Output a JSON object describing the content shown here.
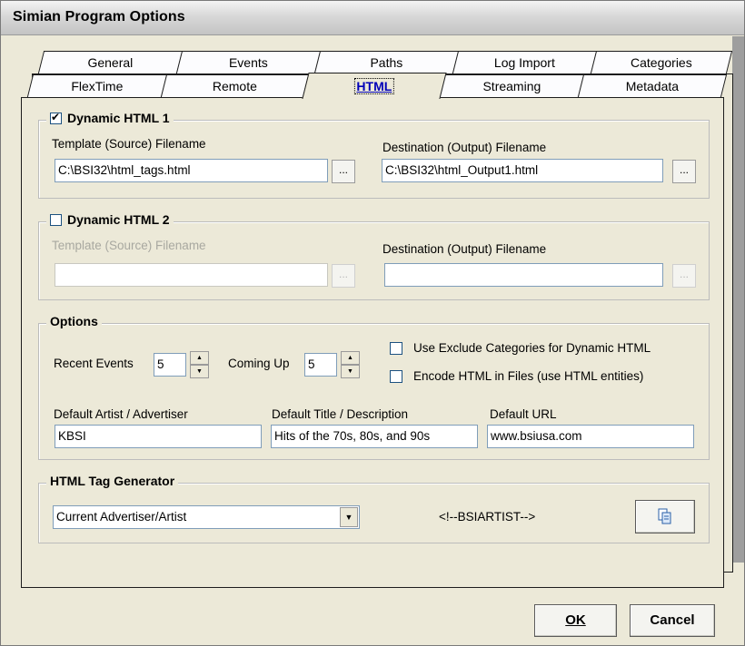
{
  "window": {
    "title": "Simian Program Options"
  },
  "tabs": {
    "row1": [
      "General",
      "Events",
      "Paths",
      "Log Import",
      "Categories"
    ],
    "row2": [
      "FlexTime",
      "Remote",
      "HTML",
      "Streaming",
      "Metadata"
    ],
    "active": "HTML"
  },
  "dyn1": {
    "checkbox_label": "Dynamic HTML 1",
    "checked": true,
    "template_label": "Template (Source) Filename",
    "template_value": "C:\\BSI32\\html_tags.html",
    "dest_label": "Destination (Output) Filename",
    "dest_value": "C:\\BSI32\\html_Output1.html",
    "browse": "..."
  },
  "dyn2": {
    "checkbox_label": "Dynamic HTML 2",
    "checked": false,
    "template_label": "Template (Source) Filename",
    "template_value": "",
    "dest_label": "Destination (Output) Filename",
    "dest_value": "",
    "browse": "..."
  },
  "options": {
    "legend": "Options",
    "recent_label": "Recent Events",
    "recent_value": "5",
    "coming_label": "Coming Up",
    "coming_value": "5",
    "exclude_label": "Use Exclude Categories for Dynamic HTML",
    "encode_label": "Encode HTML in Files (use HTML entities)",
    "artist_label": "Default Artist / Advertiser",
    "artist_value": "KBSI",
    "title_label": "Default Title / Description",
    "title_value": "Hits of the 70s, 80s, and 90s",
    "url_label": "Default URL",
    "url_value": "www.bsiusa.com"
  },
  "generator": {
    "legend": "HTML Tag Generator",
    "select_value": "Current Advertiser/Artist",
    "tag_text": "<!--BSIARTIST-->"
  },
  "buttons": {
    "ok": "OK",
    "cancel": "Cancel"
  }
}
